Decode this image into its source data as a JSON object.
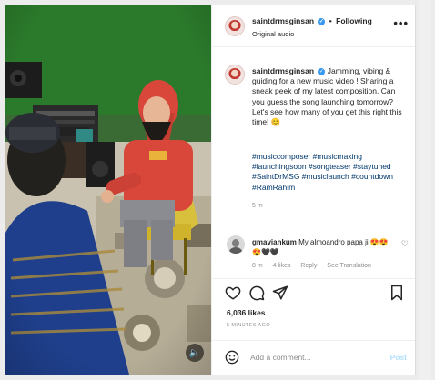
{
  "header": {
    "username": "saintdrmsginsan",
    "separator": "•",
    "follow_label": "Following",
    "subtitle": "Original audio",
    "more": "•••"
  },
  "caption": {
    "username": "saintdrmsginsan",
    "body": "Jamming, vibing & guiding for a new music video ! Sharing a sneak peek of my latest composition. Can you guess the song launching tomorrow? Let's see how many of you get this right this time! 😊",
    "hashtags": "#musiccomposer #musicmaking #launchingsoon #songteaser #staytuned #SaintDrMSG #musiclaunch #countdown #RamRahim",
    "age": "5 m"
  },
  "comment": {
    "username": "gmaviankum",
    "text": "My almoandro papa ji 😍😍😍🖤🖤",
    "heart": "♡",
    "time": "8 m",
    "likes": "4 likes",
    "reply": "Reply",
    "translation": "See Translation"
  },
  "actions": {
    "likes_count": "6,036 likes",
    "date": "5 MINUTES AGO"
  },
  "add_comment": {
    "placeholder": "Add a comment...",
    "post_label": "Post"
  },
  "media": {
    "mute_icon": "🔈"
  },
  "colors": {
    "link": "#00376b",
    "muted": "#8e8e8e",
    "text": "#262626",
    "post_disabled": "#b2dffc",
    "verified": "#3897f0",
    "wall_green": "#2b7a2b",
    "hoodie_red": "#d8473a"
  }
}
